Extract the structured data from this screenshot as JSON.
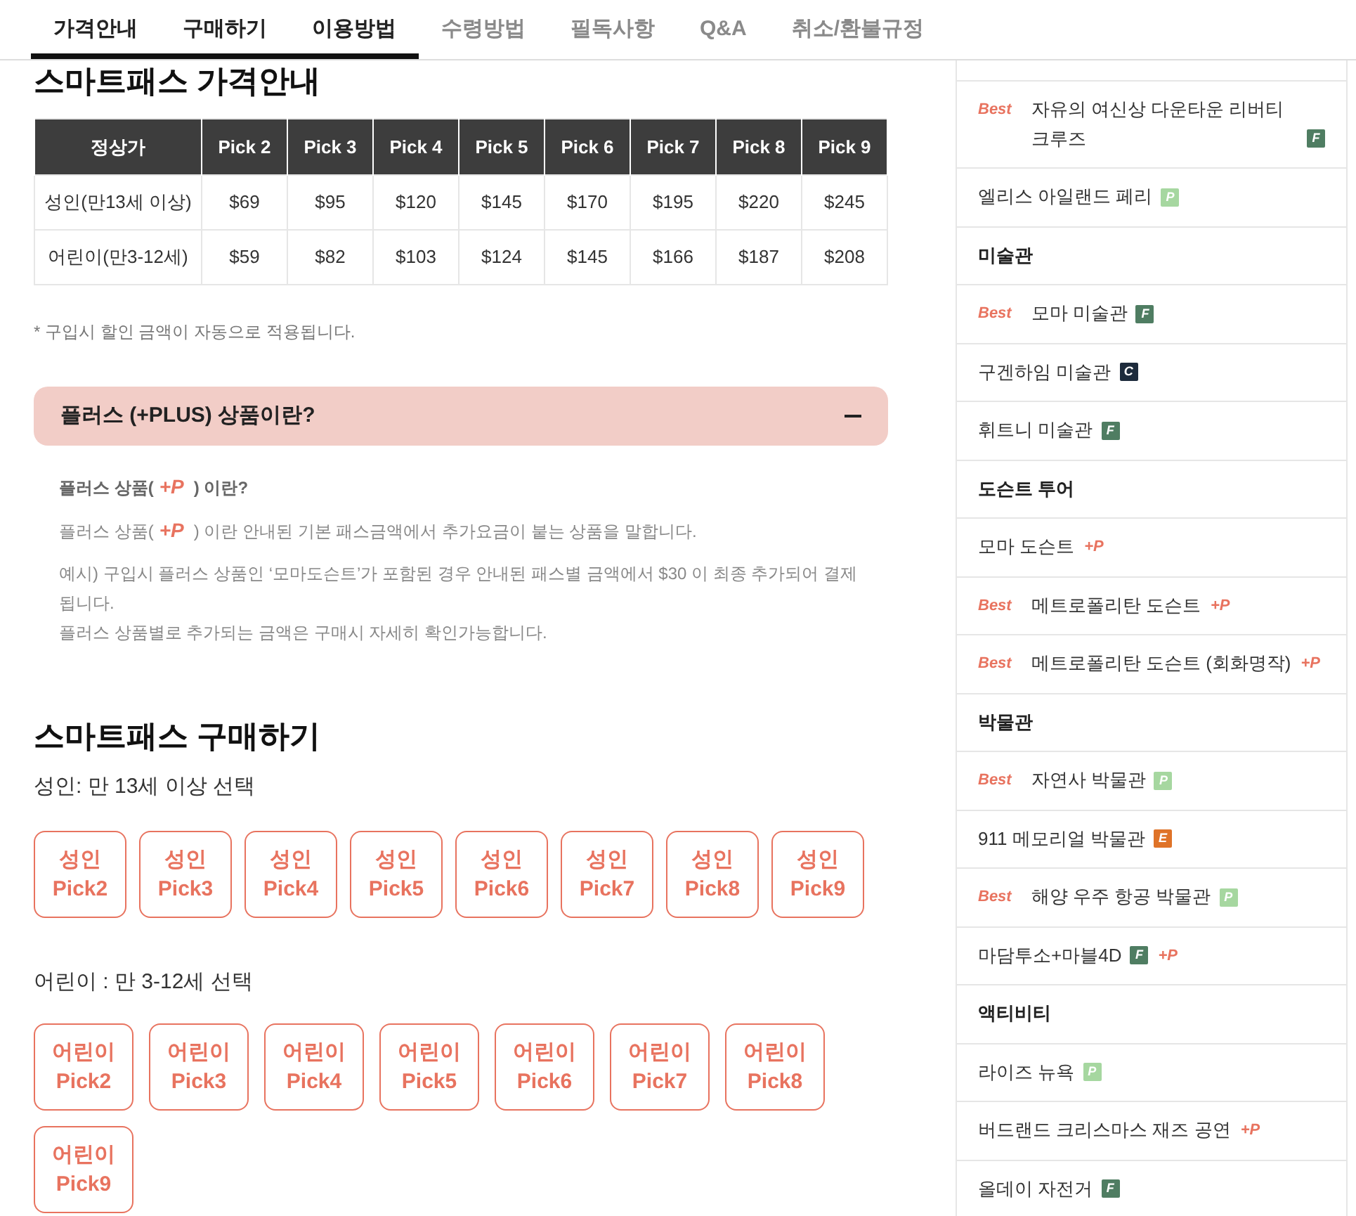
{
  "tabs": [
    {
      "label": "가격안내",
      "selected": true
    },
    {
      "label": "구매하기",
      "selected": true
    },
    {
      "label": "이용방법",
      "selected": true
    },
    {
      "label": "수령방법",
      "selected": false
    },
    {
      "label": "필독사항",
      "selected": false
    },
    {
      "label": "Q&A",
      "selected": false
    },
    {
      "label": "취소/환불규정",
      "selected": false
    }
  ],
  "price_guide": {
    "title": "스마트패스 가격안내",
    "table": {
      "columns": [
        "정상가",
        "Pick 2",
        "Pick 3",
        "Pick 4",
        "Pick 5",
        "Pick 6",
        "Pick 7",
        "Pick 8",
        "Pick 9"
      ],
      "rows": [
        [
          "성인(만13세 이상)",
          "$69",
          "$95",
          "$120",
          "$145",
          "$170",
          "$195",
          "$220",
          "$245"
        ],
        [
          "어린이(만3-12세)",
          "$59",
          "$82",
          "$103",
          "$124",
          "$145",
          "$166",
          "$187",
          "$208"
        ]
      ]
    },
    "note": "* 구입시 할인 금액이 자동으로 적용됩니다."
  },
  "plus_info": {
    "title": "플러스 (+PLUS) 상품이란?",
    "expanded": true,
    "heading": {
      "before": "플러스 상품(",
      "mark": "+P",
      "after": ") 이란?"
    },
    "definition": {
      "before": "플러스 상품(",
      "mark": "+P",
      "after": ") 이란 안내된 기본 패스금액에서 추가요금이 붙는 상품을 말합니다."
    },
    "example_lines": [
      "예시) 구입시 플러스 상품인 ‘모마도슨트’가 포함된 경우 안내된 패스별 금액에서 $30 이 최종 추가되어 결제됩니다.",
      "플러스 상품별로 추가되는 금액은 구매시 자세히 확인가능합니다."
    ]
  },
  "purchase": {
    "title": "스마트패스 구매하기",
    "groups": [
      {
        "label": "성인: 만 13세 이상 선택",
        "buttons": [
          [
            "성인",
            "Pick2"
          ],
          [
            "성인",
            "Pick3"
          ],
          [
            "성인",
            "Pick4"
          ],
          [
            "성인",
            "Pick5"
          ],
          [
            "성인",
            "Pick6"
          ],
          [
            "성인",
            "Pick7"
          ],
          [
            "성인",
            "Pick8"
          ],
          [
            "성인",
            "Pick9"
          ]
        ]
      },
      {
        "label": "어린이 : 만 3-12세 선택",
        "buttons": [
          [
            "어린이",
            "Pick2"
          ],
          [
            "어린이",
            "Pick3"
          ],
          [
            "어린이",
            "Pick4"
          ],
          [
            "어린이",
            "Pick5"
          ],
          [
            "어린이",
            "Pick6"
          ],
          [
            "어린이",
            "Pick7"
          ],
          [
            "어린이",
            "Pick8"
          ],
          [
            "어린이",
            "Pick9"
          ]
        ]
      }
    ]
  },
  "sidebar": {
    "items": [
      {
        "kind": "product",
        "tag": "Best",
        "name": "자유의 여신상 다운타운 리버티 크루즈",
        "marks": [
          {
            "kind": "tile",
            "label": "F",
            "color": "#4f7d62"
          }
        ]
      },
      {
        "kind": "product",
        "name": "엘리스 아일랜드 페리",
        "marks": [
          {
            "kind": "tile",
            "label": "P",
            "color": "#a6d7a0"
          }
        ]
      },
      {
        "kind": "category",
        "name": "미술관"
      },
      {
        "kind": "product",
        "tag": "Best",
        "name": "모마 미술관",
        "marks": [
          {
            "kind": "tile",
            "label": "F",
            "color": "#4f7d62"
          }
        ]
      },
      {
        "kind": "product",
        "name": "구겐하임 미술관",
        "marks": [
          {
            "kind": "tile",
            "label": "C",
            "color": "#1d2b3c"
          }
        ]
      },
      {
        "kind": "product",
        "name": "휘트니 미술관",
        "marks": [
          {
            "kind": "tile",
            "label": "F",
            "color": "#4f7d62"
          }
        ]
      },
      {
        "kind": "category",
        "name": "도슨트 투어"
      },
      {
        "kind": "product",
        "name": "모마 도슨트",
        "marks": [
          {
            "kind": "plus",
            "label": "+P"
          }
        ]
      },
      {
        "kind": "product",
        "tag": "Best",
        "name": "메트로폴리탄 도슨트",
        "marks": [
          {
            "kind": "plus",
            "label": "+P"
          }
        ]
      },
      {
        "kind": "product",
        "tag": "Best",
        "name": "메트로폴리탄 도슨트 (회화명작)",
        "marks": [
          {
            "kind": "plus",
            "label": "+P"
          }
        ]
      },
      {
        "kind": "category",
        "name": "박물관"
      },
      {
        "kind": "product",
        "tag": "Best",
        "name": "자연사 박물관",
        "marks": [
          {
            "kind": "tile",
            "label": "P",
            "color": "#a6d7a0"
          }
        ]
      },
      {
        "kind": "product",
        "name": "911 메모리얼 박물관",
        "marks": [
          {
            "kind": "tile",
            "label": "E",
            "color": "#df7328"
          }
        ]
      },
      {
        "kind": "product",
        "tag": "Best",
        "name": "해양 우주 항공 박물관",
        "marks": [
          {
            "kind": "tile",
            "label": "P",
            "color": "#a6d7a0"
          }
        ]
      },
      {
        "kind": "product",
        "name": "마담투소+마블4D",
        "marks": [
          {
            "kind": "tile",
            "label": "F",
            "color": "#4f7d62"
          },
          {
            "kind": "plus",
            "label": "+P"
          }
        ]
      },
      {
        "kind": "category",
        "name": "액티비티"
      },
      {
        "kind": "product",
        "name": "라이즈 뉴욕",
        "marks": [
          {
            "kind": "tile",
            "label": "P",
            "color": "#a6d7a0"
          }
        ]
      },
      {
        "kind": "product",
        "name": "버드랜드 크리스마스 재즈 공연",
        "marks": [
          {
            "kind": "plus",
            "label": "+P"
          }
        ]
      },
      {
        "kind": "product",
        "name": "올데이 자전거",
        "marks": [
          {
            "kind": "tile",
            "label": "F",
            "color": "#4f7d62"
          }
        ]
      }
    ]
  }
}
